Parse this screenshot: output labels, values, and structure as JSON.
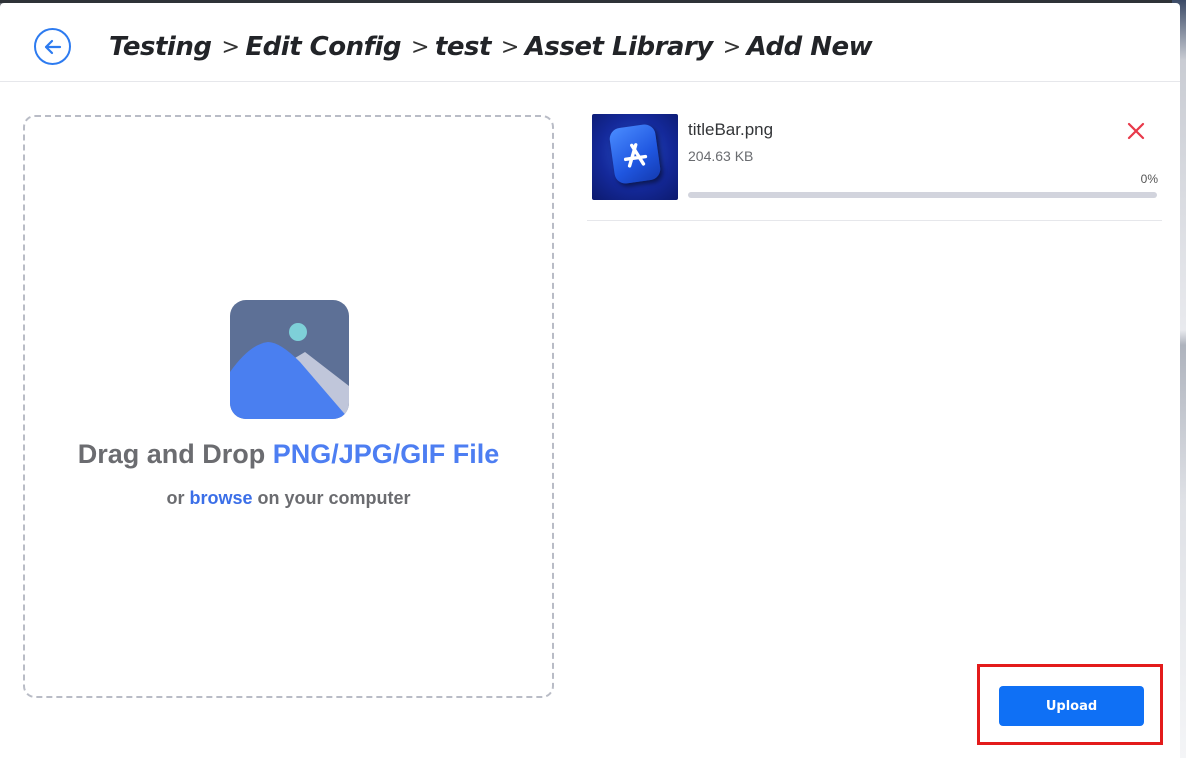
{
  "header": {
    "breadcrumb": [
      "Testing",
      "Edit Config",
      "test",
      "Asset Library",
      "Add New"
    ],
    "separator": ">"
  },
  "dropzone": {
    "title_prefix": "Drag and Drop",
    "title_accent": "PNG/JPG/GIF File",
    "sub_prefix": "or",
    "browse_link": "browse",
    "sub_suffix": "on your computer"
  },
  "file": {
    "name": "titleBar.png",
    "size": "204.63 KB",
    "progress_label": "0%",
    "progress_fraction": 0
  },
  "actions": {
    "upload_label": "Upload"
  },
  "colors": {
    "accent": "#2d7bf0",
    "primary_button": "#0f70f5",
    "highlight": "#e31b1b",
    "remove": "#e8394a"
  },
  "icons": {
    "back": "arrow-left-circle-icon",
    "remove": "close-icon",
    "placeholder": "image-placeholder-icon",
    "file_thumbnail": "app-store-icon"
  }
}
